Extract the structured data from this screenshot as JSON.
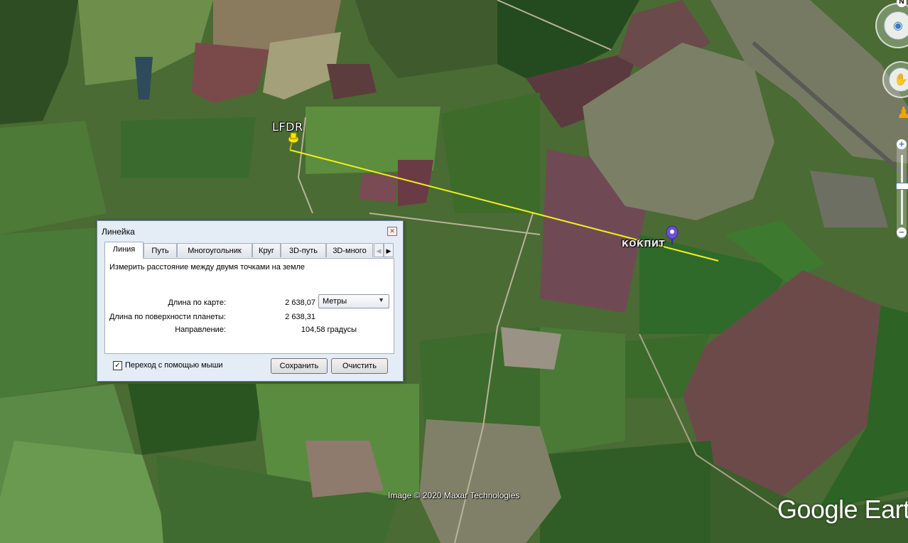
{
  "map": {
    "placemarks": [
      {
        "label": "LFDR",
        "color": "#f5e400"
      },
      {
        "label": "КОКПИТ",
        "color": "#6b4fd8"
      }
    ],
    "measure_line_color": "#f2ef1e",
    "copyright": "Image © 2020 Maxar Technologies",
    "brand": "Google Eart"
  },
  "nav": {
    "north_label": "N",
    "zoom_in": "+",
    "zoom_out": "−"
  },
  "ruler": {
    "title": "Линейка",
    "tabs": [
      "Линия",
      "Путь",
      "Многоугольник",
      "Круг",
      "3D-путь",
      "3D-много"
    ],
    "active_tab": 0,
    "hint": "Измерить расстояние между двумя точками на земле",
    "map_length_label": "Длина по карте:",
    "map_length_value": "2 638,07",
    "units": "Метры",
    "surface_length_label": "Длина по поверхности планеты:",
    "surface_length_value": "2 638,31",
    "heading_label": "Направление:",
    "heading_value": "104,58 градусы",
    "mouse_nav_label": "Переход с помощью мыши",
    "mouse_nav_checked": true,
    "save_label": "Сохранить",
    "clear_label": "Очистить"
  }
}
